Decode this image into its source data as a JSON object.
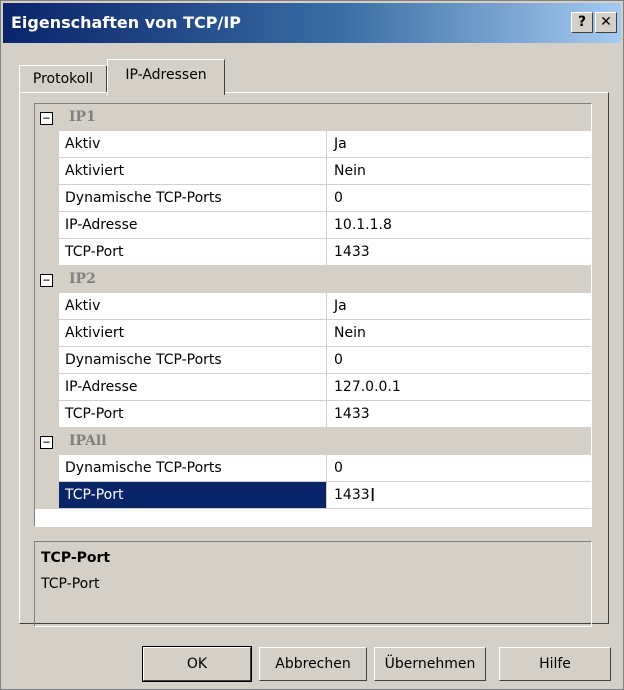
{
  "window": {
    "title": "Eigenschaften von TCP/IP",
    "help_button": "?",
    "close_button": "✕"
  },
  "tabs": [
    {
      "label": "Protokoll",
      "active": false
    },
    {
      "label": "IP-Adressen",
      "active": true
    }
  ],
  "grid": {
    "toggle_symbol": "−",
    "categories": [
      {
        "name": "IP1",
        "properties": [
          {
            "name": "Aktiv",
            "value": "Ja"
          },
          {
            "name": "Aktiviert",
            "value": "Nein"
          },
          {
            "name": "Dynamische TCP-Ports",
            "value": "0"
          },
          {
            "name": "IP-Adresse",
            "value": "10.1.1.8"
          },
          {
            "name": "TCP-Port",
            "value": "1433"
          }
        ]
      },
      {
        "name": "IP2",
        "properties": [
          {
            "name": "Aktiv",
            "value": "Ja"
          },
          {
            "name": "Aktiviert",
            "value": "Nein"
          },
          {
            "name": "Dynamische TCP-Ports",
            "value": "0"
          },
          {
            "name": "IP-Adresse",
            "value": "127.0.0.1"
          },
          {
            "name": "TCP-Port",
            "value": "1433"
          }
        ]
      },
      {
        "name": "IPAll",
        "properties": [
          {
            "name": "Dynamische TCP-Ports",
            "value": "0"
          },
          {
            "name": "TCP-Port",
            "value": "1433",
            "selected": true
          }
        ]
      }
    ]
  },
  "description": {
    "title": "TCP-Port",
    "text": "TCP-Port"
  },
  "buttons": {
    "ok": "OK",
    "cancel": "Abbrechen",
    "apply": "Übernehmen",
    "help": "Hilfe"
  },
  "colors": {
    "selection": "#0a246a",
    "face": "#d4d0c8"
  }
}
